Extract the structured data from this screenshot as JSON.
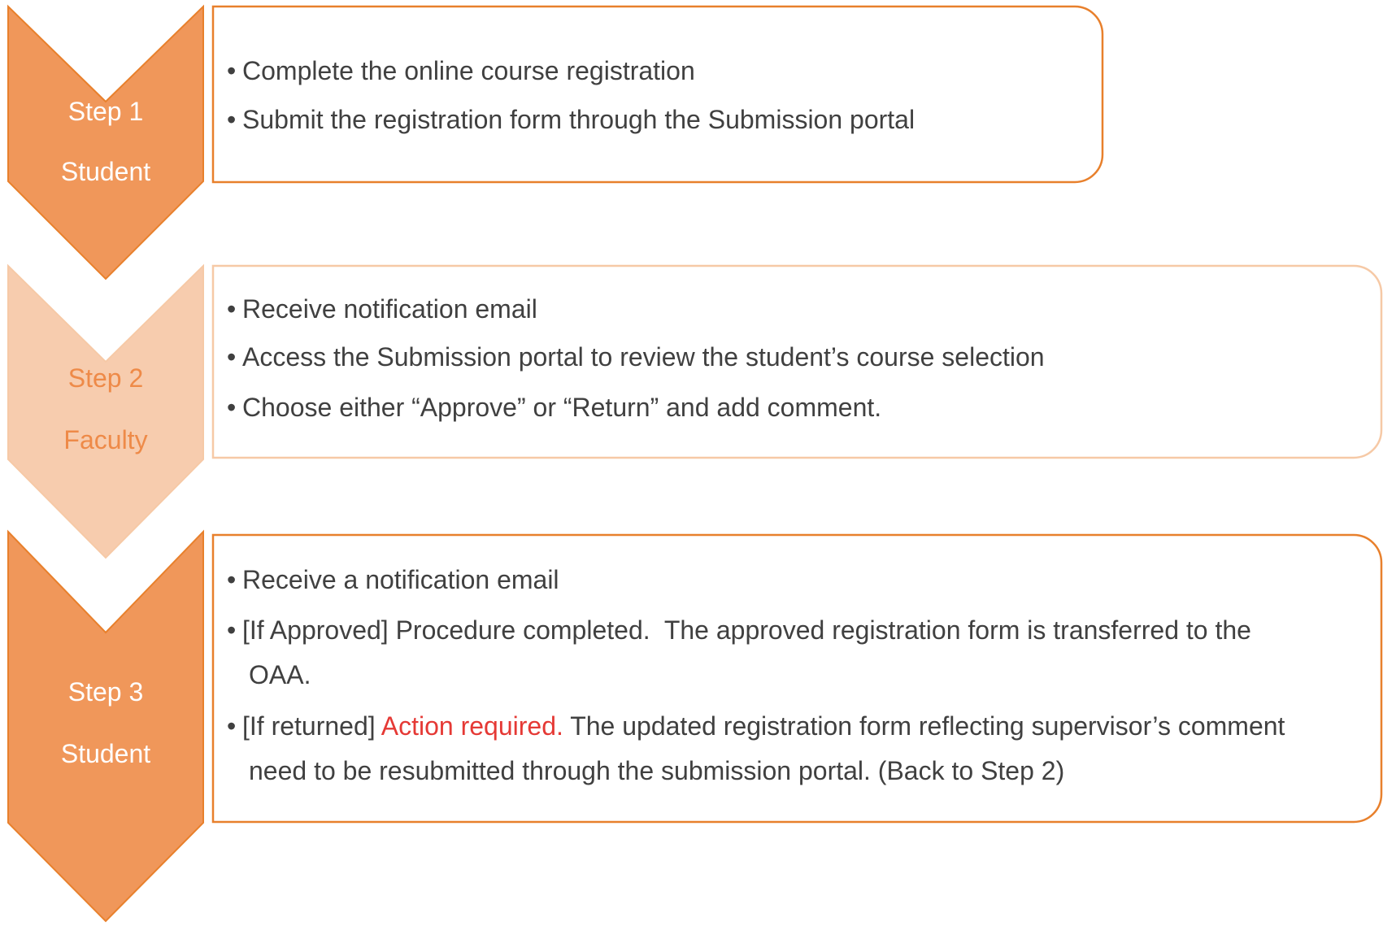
{
  "colors": {
    "accent": "#f0975a",
    "accent_light": "#f7ccae",
    "accent_border": "#e8802c",
    "accent_border_light": "#f6c9a6",
    "text": "#404040",
    "step_label_white": "#ffffff",
    "step_label_on_light": "#ee8a48",
    "highlight_red": "#e53935"
  },
  "steps": [
    {
      "number_label": "Step 1",
      "role_label": "Student",
      "bullets": [
        {
          "text": "Complete the online course registration"
        },
        {
          "text": "Submit the registration form through the Submission portal"
        }
      ]
    },
    {
      "number_label": "Step 2",
      "role_label": "Faculty",
      "bullets": [
        {
          "text": "Receive notification email"
        },
        {
          "text": "Access the Submission portal to review the student’s course selection"
        },
        {
          "text": "Choose either “Approve” or “Return” and add comment."
        }
      ]
    },
    {
      "number_label": "Step 3",
      "role_label": "Student",
      "bullets": [
        {
          "text": "Receive a notification email"
        },
        {
          "line1": "[If Approved] Procedure completed.  The approved registration form is transferred to the",
          "line2": "OAA."
        },
        {
          "prefix": "[If returned] ",
          "highlight": "Action required.",
          "suffix": " The updated registration form reflecting supervisor’s comment",
          "line2": "need to be resubmitted through the submission portal. (Back to Step 2)"
        }
      ]
    }
  ]
}
